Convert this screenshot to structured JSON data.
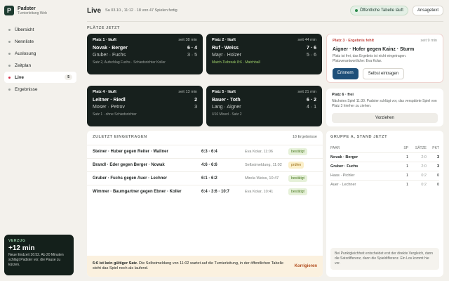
{
  "brand": {
    "name": "Padster",
    "subtitle": "Turnierleitung Web",
    "logo_letter": "P"
  },
  "nav": [
    {
      "label": "Übersicht"
    },
    {
      "label": "Nennliste"
    },
    {
      "label": "Auslosung"
    },
    {
      "label": "Zeitplan"
    },
    {
      "label": "Live",
      "badge": "5",
      "active": true
    },
    {
      "label": "Ergebnisse"
    }
  ],
  "delay": {
    "label": "VERZUG",
    "value": "+12 min",
    "text": "Neue Endzeit 16:52. Ab 20 Minuten schlägt Padster vor, die Pause zu kürzen."
  },
  "header": {
    "title": "Live",
    "subtitle": "Sa 03.10., 11:12 · 18 von 47 Spielen fertig",
    "status": "Öffentliche Tabelle läuft",
    "button": "Ansagetext"
  },
  "section_label": "PLÄTZE JETZT",
  "courts": [
    {
      "name": "Platz 1 · läuft",
      "time": "seit 38 min",
      "team1": "Novak · Berger",
      "score1": "6 · 4",
      "team2": "Gruber · Fuchs",
      "score2": "3 · 5",
      "note": "Satz 2, Aufschlag Fuchs · Schiedsrichter Koller",
      "note_color": "grey"
    },
    {
      "name": "Platz 2 · läuft",
      "time": "seit 44 min",
      "team1": "Ruf · Weiss",
      "score1": "7 · 6",
      "team2": "Mayr · Holzer",
      "score2": "5 · 6",
      "note": "Match-Tiebreak 8:6 · Matchball",
      "note_color": "green"
    },
    {
      "name": "Platz 4 · läuft",
      "time": "seit 13 min",
      "team1": "Leitner · Riedl",
      "score1": "2",
      "team2": "Moser · Petrov",
      "score2": "3",
      "note": "Satz 1 · ohne Schiedsrichter",
      "note_color": "grey"
    },
    {
      "name": "Platz 5 · läuft",
      "time": "seit 21 min",
      "team1": "Bauer · Toth",
      "score1": "6 · 2",
      "team2": "Lang · Aigner",
      "score2": "4 · 1",
      "note": "U16 Mixed · Satz 2",
      "note_color": "grey"
    }
  ],
  "alert": {
    "title": "Platz 3 · Ergebnis fehlt",
    "time": "seit 9 min",
    "names": "Aigner · Hofer gegen Kainz · Sturm",
    "text": "Platz ist frei, das Ergebnis ist nicht eingetragen. Platzverantwortliche: Eva Kolar.",
    "btn1": "Erinnern",
    "btn2": "Selbst eintragen"
  },
  "free": {
    "title": "Platz 6 · frei",
    "text": "Nächstes Spiel 11:30. Padster schlägt vor, das verspätete Spiel von Platz 3 hierher zu ziehen.",
    "button": "Vorziehen"
  },
  "entries": {
    "title": "ZULETZT EINGETRAGEN",
    "count": "18 Ergebnisse",
    "rows": [
      {
        "match": "Steiner · Huber gegen Reiter · Wallner",
        "score": "6:3 · 6:4",
        "who": "Eva Kolar, 11:06",
        "status": "bestätigt",
        "type": "ok"
      },
      {
        "match": "Brandl · Eder gegen Berger · Nowak",
        "score": "4:6 · 6:6",
        "who": "Selbstmeldung, 11:02",
        "status": "prüfen",
        "type": "check"
      },
      {
        "match": "Gruber · Fuchs gegen Auer · Lechner",
        "score": "6:1 · 6:2",
        "who": "Mirela Weiss, 10:47",
        "status": "bestätigt",
        "type": "ok"
      },
      {
        "match": "Wimmer · Baumgartner gegen Ebner · Koller",
        "score": "6:4 · 3:6 · 10:7",
        "who": "Eva Kolar, 10:41",
        "status": "bestätigt",
        "type": "ok"
      }
    ],
    "invalid_bold": "6:6 ist kein gültiger Satz.",
    "invalid_text": " Die Selbstmeldung von 11:02 wartet auf die Turnierleitung, in der öffentlichen Tabelle steht das Spiel noch als laufend.",
    "invalid_button": "Korrigieren"
  },
  "standings": {
    "title": "GRUPPE A, STAND JETZT",
    "headers": {
      "pair": "PAAR",
      "sp": "SP",
      "saetze": "SÄTZE",
      "pkt": "PKT"
    },
    "rows": [
      {
        "pair": "Novak · Berger",
        "sp": "1",
        "saetze": "2:0",
        "pkt": "3",
        "strong": true
      },
      {
        "pair": "Gruber · Fuchs",
        "sp": "1",
        "saetze": "2:0",
        "pkt": "3",
        "strong": true
      },
      {
        "pair": "Haas · Pichler",
        "sp": "1",
        "saetze": "0:2",
        "pkt": "0",
        "strong": false
      },
      {
        "pair": "Auer · Lechner",
        "sp": "1",
        "saetze": "0:2",
        "pkt": "0",
        "strong": false
      }
    ],
    "note": "Bei Punktgleichheit entscheidet erst der direkte Vergleich, dann die Satzdifferenz, dann die Spieldifferenz. Ein Los kommt hie vor."
  }
}
